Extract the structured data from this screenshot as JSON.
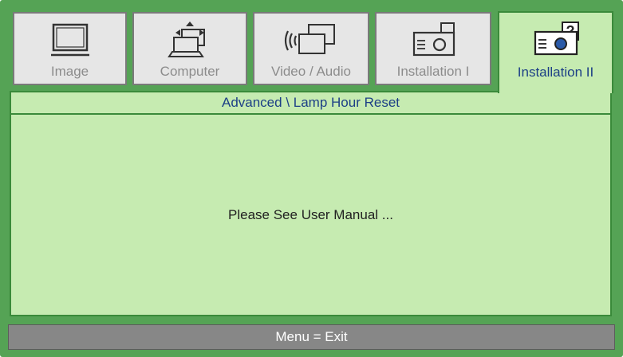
{
  "tabs": [
    {
      "label": "Image",
      "icon": "monitor-icon",
      "active": false
    },
    {
      "label": "Computer",
      "icon": "computer-icon",
      "active": false
    },
    {
      "label": "Video / Audio",
      "icon": "video-audio-icon",
      "active": false
    },
    {
      "label": "Installation I",
      "icon": "projector-icon",
      "active": false
    },
    {
      "label": "Installation II",
      "icon": "projector-help-icon",
      "active": true
    }
  ],
  "panel": {
    "breadcrumb": "Advanced \\ Lamp Hour Reset",
    "message": "Please See User Manual ..."
  },
  "footer": {
    "hint": "Menu = Exit"
  },
  "colors": {
    "frame": "#55a355",
    "panel": "#c6ebb1",
    "active_text": "#1c3f86",
    "inactive_tab": "#e6e6e6",
    "footer": "#878787"
  }
}
